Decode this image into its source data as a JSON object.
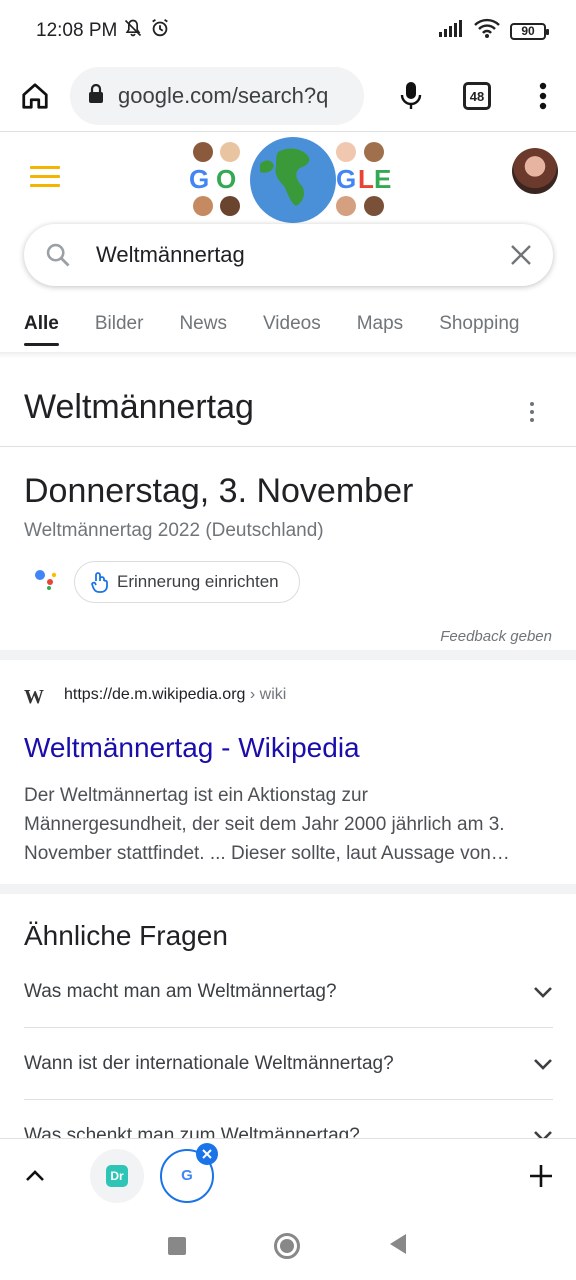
{
  "status": {
    "time": "12:08 PM",
    "battery": "90"
  },
  "browser": {
    "url": "google.com/search?q",
    "tab_count": "48"
  },
  "search": {
    "query": "Weltmännertag"
  },
  "tabs": [
    {
      "label": "Alle",
      "active": true
    },
    {
      "label": "Bilder"
    },
    {
      "label": "News"
    },
    {
      "label": "Videos"
    },
    {
      "label": "Maps"
    },
    {
      "label": "Shopping"
    }
  ],
  "knowledge": {
    "heading": "Weltmännertag",
    "date": "Donnerstag, 3. November",
    "subtitle": "Weltmännertag 2022 (Deutschland)",
    "reminder_label": "Erinnerung einrichten",
    "feedback": "Feedback geben"
  },
  "result": {
    "favicon": "W",
    "url": "https://de.m.wikipedia.org",
    "breadcrumb": "› wiki",
    "title": "Weltmännertag - Wikipedia",
    "snippet_lines": [
      "Der Weltmännertag ist ein Aktionstag zur",
      "Männergesundheit, der seit dem Jahr 2000 jährlich am 3.",
      "November stattfindet. ... Dieser sollte, laut Aussage von…"
    ]
  },
  "paa": {
    "title": "Ähnliche Fragen",
    "questions": [
      "Was macht man am Weltmännertag?",
      "Wann ist der internationale Weltmännertag?",
      "Was schenkt man zum Weltmännertag?"
    ]
  },
  "bottom": {
    "google_tab_letter": "G",
    "dr_tab_label": "Dr"
  },
  "colors": {
    "link": "#1a0dab",
    "accent_yellow": "#f4b400",
    "close_badge": "#1a73e8"
  }
}
